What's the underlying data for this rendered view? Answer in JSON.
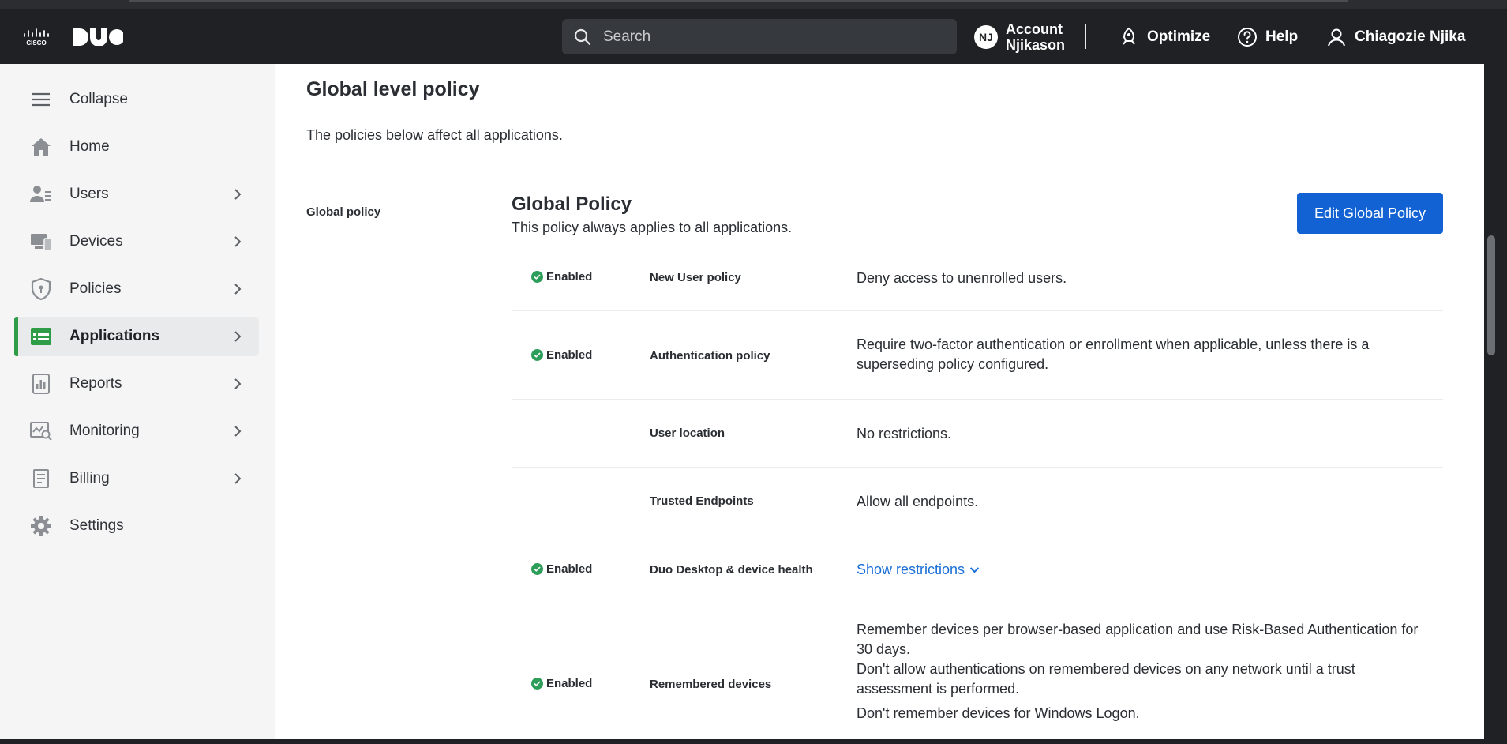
{
  "header": {
    "search_placeholder": "Search",
    "account_initials": "NJ",
    "account_line1": "Account",
    "account_line2": "Njikason",
    "optimize_label": "Optimize",
    "help_label": "Help",
    "user_name": "Chiagozie Njika"
  },
  "sidebar": {
    "items": [
      {
        "label": "Collapse",
        "icon": "menu-icon"
      },
      {
        "label": "Home",
        "icon": "home-icon"
      },
      {
        "label": "Users",
        "icon": "users-icon"
      },
      {
        "label": "Devices",
        "icon": "devices-icon"
      },
      {
        "label": "Policies",
        "icon": "shield-icon"
      },
      {
        "label": "Applications",
        "icon": "applications-icon"
      },
      {
        "label": "Reports",
        "icon": "reports-icon"
      },
      {
        "label": "Monitoring",
        "icon": "monitoring-icon"
      },
      {
        "label": "Billing",
        "icon": "billing-icon"
      },
      {
        "label": "Settings",
        "icon": "gear-icon"
      }
    ],
    "active": "Applications"
  },
  "main": {
    "title": "Global level policy",
    "description": "The policies below affect all applications.",
    "section_label": "Global policy",
    "policy_title": "Global Policy",
    "policy_subtitle": "This policy always applies to all applications.",
    "edit_button": "Edit Global Policy",
    "rows": [
      {
        "status": "Enabled",
        "name": "New User policy",
        "value": "Deny access to unenrolled users."
      },
      {
        "status": "Enabled",
        "name": "Authentication policy",
        "value": "Require two-factor authentication or enrollment when applicable, unless there is a superseding policy configured."
      },
      {
        "status": "",
        "name": "User location",
        "value": "No restrictions."
      },
      {
        "status": "",
        "name": "Trusted Endpoints",
        "value": "Allow all endpoints."
      },
      {
        "status": "Enabled",
        "name": "Duo Desktop & device health",
        "value": "Show restrictions"
      },
      {
        "status": "Enabled",
        "name": "Remembered devices",
        "value": "Remember devices per browser-based application and use Risk-Based Authentication for 30 days.",
        "value2": "Don't allow authentications on remembered devices on any network until a trust assessment is performed.",
        "value3": "Don't remember devices for Windows Logon."
      }
    ]
  },
  "colors": {
    "accent": "#1262d4",
    "enabled": "#2d9d5a",
    "active_bar": "#2f9d47",
    "link": "#1a6ed8"
  }
}
